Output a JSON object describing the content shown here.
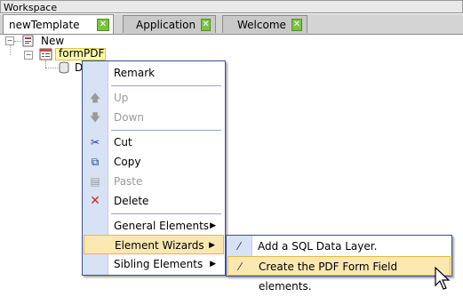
{
  "window": {
    "title": "Workspace"
  },
  "tabs": [
    {
      "label": "newTemplate",
      "active": true
    },
    {
      "label": "Application",
      "active": false
    },
    {
      "label": "Welcome",
      "active": false
    }
  ],
  "tree": {
    "root_label": "New",
    "selected_label": "formPDF",
    "child_label_partial": "D"
  },
  "context_menu": {
    "items": [
      {
        "label": "Remark",
        "icon": "none",
        "enabled": true
      },
      {
        "label": "Up",
        "icon": "arrow-up-icon",
        "enabled": false
      },
      {
        "label": "Down",
        "icon": "arrow-down-icon",
        "enabled": false
      },
      {
        "label": "Cut",
        "icon": "scissors-icon",
        "enabled": true
      },
      {
        "label": "Copy",
        "icon": "copy-icon",
        "enabled": true
      },
      {
        "label": "Paste",
        "icon": "paste-icon",
        "enabled": false
      },
      {
        "label": "Delete",
        "icon": "red-x-icon",
        "enabled": true
      },
      {
        "label": "General Elements",
        "submenu": true
      },
      {
        "label": "Element Wizards",
        "submenu": true,
        "highlighted": true
      },
      {
        "label": "Sibling Elements",
        "submenu": true
      }
    ]
  },
  "submenu": {
    "items": [
      {
        "label": "Add a SQL Data Layer.",
        "icon": "magic-wand-icon"
      },
      {
        "label": "Create the PDF Form Field elements.",
        "icon": "magic-wand-icon",
        "highlighted": true
      }
    ]
  },
  "colors": {
    "menu_border": "#3a4f9a",
    "menu_gutter": "#d7e3f4",
    "highlight_bg": "#fbe8b0",
    "highlight_border": "#e6b842",
    "tab_close_green": "#7cc242",
    "selection_bg": "#fafaaa"
  }
}
